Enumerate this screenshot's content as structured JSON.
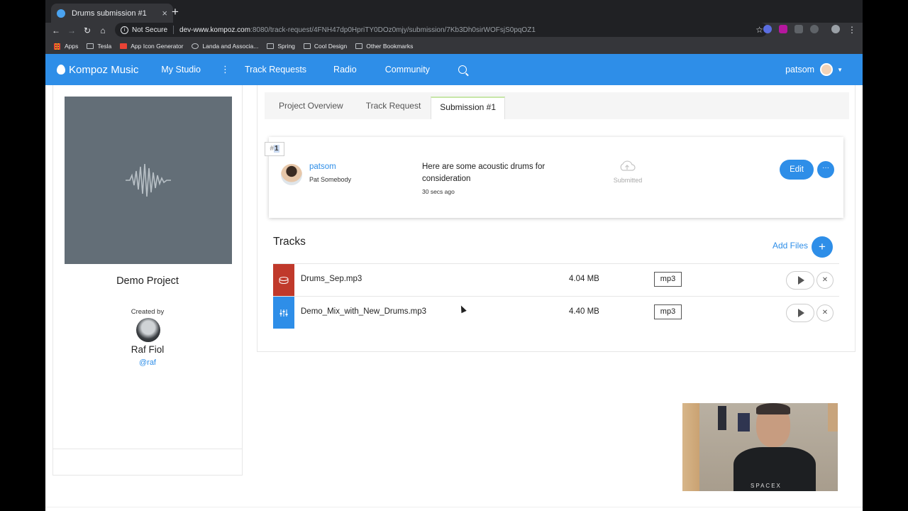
{
  "browser": {
    "tab_title": "Drums submission #1",
    "tab_close": "×",
    "new_tab": "+",
    "not_secure": "Not Secure",
    "url_host": "dev-www.kompoz.com",
    "url_path": ":8080/track-request/4FNH47dp0HpriTY0DOz0mjy/submission/7Kb3Dh0sirWOFsjS0pqOZ1",
    "bookmarks": [
      "Apps",
      "Tesla",
      "App Icon Generator",
      "Landa and Associa...",
      "Spring",
      "Cool Design"
    ],
    "other_bookmarks": "Other Bookmarks"
  },
  "header": {
    "brand": "Kompoz Music",
    "nav": [
      "My Studio",
      "Track Requests",
      "Radio",
      "Community"
    ],
    "kebab": "⋮",
    "username": "patsom",
    "caret": "▼"
  },
  "project": {
    "title": "Demo Project",
    "created_by_label": "Created by",
    "creator_name": "Raf Fiol",
    "creator_handle": "@raf"
  },
  "tabs": [
    "Project Overview",
    "Track Request",
    "Submission #1"
  ],
  "submission": {
    "number": "1",
    "number_prefix": "#",
    "user": "patsom",
    "full_name": "Pat Somebody",
    "message": "Here are some acoustic drums for consideration",
    "time": "30 secs ago",
    "status": "Submitted",
    "edit_label": "Edit",
    "more_label": "···"
  },
  "tracks": {
    "title": "Tracks",
    "add_files_label": "Add Files",
    "add_icon": "+",
    "items": [
      {
        "name": "Drums_Sep.mp3",
        "size": "4.04 MB",
        "format": "mp3",
        "color": "#c0392b",
        "icon": "drum-icon"
      },
      {
        "name": "Demo_Mix_with_New_Drums.mp3",
        "size": "4.40 MB",
        "format": "mp3",
        "color": "#2e8ee8",
        "icon": "mixer-icon"
      }
    ],
    "remove_icon": "✕"
  },
  "webcam": {
    "shirt_text": "SPACEX"
  },
  "colors": {
    "brand": "#2e8ee8",
    "cover": "#636e77"
  }
}
